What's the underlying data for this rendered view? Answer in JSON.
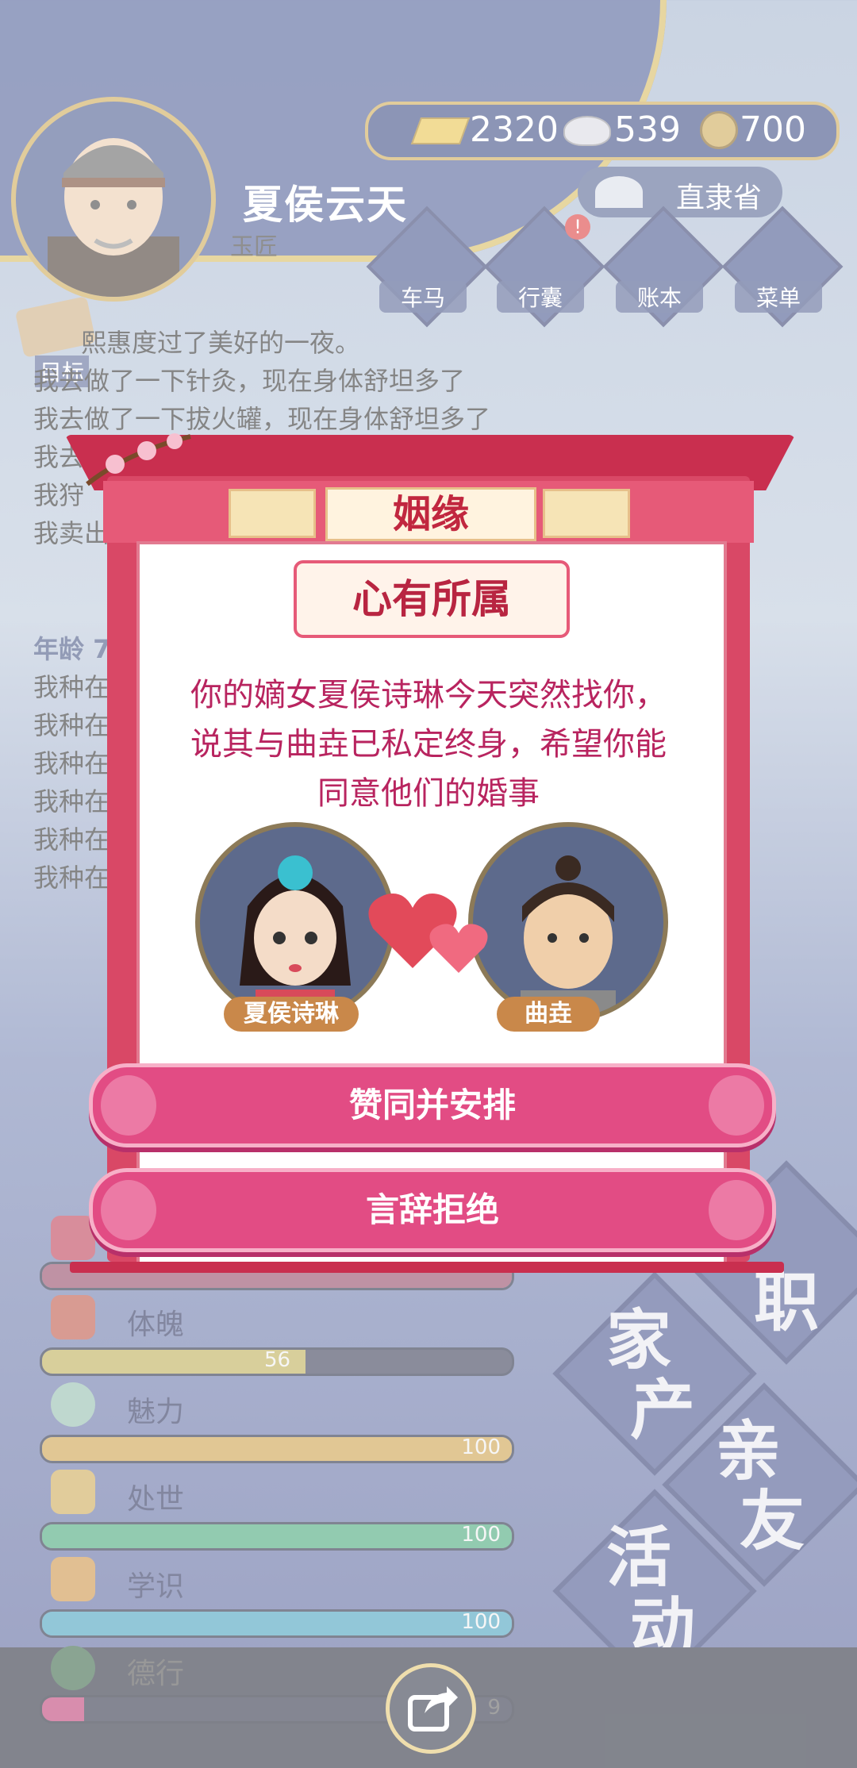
{
  "currency": {
    "gold": "2320",
    "silver": "539",
    "coin": "700"
  },
  "profile": {
    "name": "夏侯云天",
    "title": "玉匠",
    "location": "直隶省",
    "target_label": "目标"
  },
  "nav": [
    {
      "label": "车马",
      "icon": "carriage-icon"
    },
    {
      "label": "行囊",
      "icon": "bag-icon"
    },
    {
      "label": "账本",
      "icon": "ledger-icon"
    },
    {
      "label": "菜单",
      "icon": "menu-icon"
    }
  ],
  "log": {
    "lines": [
      "熙惠度过了美好的一夜。",
      "我去做了一下针灸，现在身体舒坦多了",
      "我去做了一下拔火罐，现在身体舒坦多了",
      "我去体",
      "我狩",
      "我卖出"
    ],
    "age_label": "年龄 7",
    "lines2": [
      "我种在",
      "我种在",
      "我种在",
      "我种在",
      "我种在",
      "我种在"
    ]
  },
  "modal": {
    "header": "姻缘",
    "subtitle": "心有所属",
    "message_lines": [
      "你的嫡女夏侯诗琳今天突然找你，",
      "说其与曲垚已私定终身，希望你能",
      "同意他们的婚事"
    ],
    "person_left": "夏侯诗琳",
    "person_right": "曲垚",
    "accept_label": "赞同并安排",
    "reject_label": "言辞拒绝"
  },
  "stats": [
    {
      "label": "体魄",
      "value": "56",
      "fraction": 0.56,
      "color": "#b9a84a"
    },
    {
      "label": "魅力",
      "value": "100",
      "fraction": 1.0,
      "color": "#c99a3c"
    },
    {
      "label": "处世",
      "value": "100",
      "fraction": 1.0,
      "color": "#3aa070"
    },
    {
      "label": "学识",
      "value": "100",
      "fraction": 1.0,
      "color": "#3a9ab8"
    },
    {
      "label": "德行",
      "value": "9",
      "fraction": 0.09,
      "color": "#b8306a"
    }
  ],
  "side_menu": {
    "job": "职",
    "estate_1": "家",
    "estate_2": "产",
    "kin_1": "亲",
    "kin_2": "友",
    "act_1": "活",
    "act_2": "动"
  }
}
